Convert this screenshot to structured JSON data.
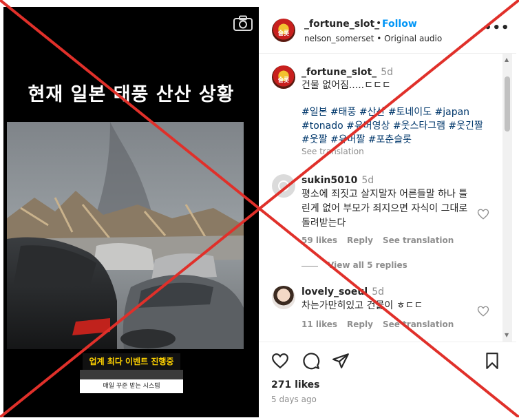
{
  "video": {
    "caption": "현재 일본 태풍 산산 상황",
    "banner_line1": "업계 최다 이벤트 진행중",
    "banner_line2": "",
    "banner_line3": "매일 꾸준 받는 시스템"
  },
  "header": {
    "username": "_fortune_slot_",
    "separator": "•",
    "follow_label": "Follow",
    "subtitle": "nelson_somerset • Original audio",
    "more": "•••"
  },
  "caption_post": {
    "username": "_fortune_slot_",
    "time": "5d",
    "text": "건물 없어짐.....ㄷㄷㄷ",
    "hashtags": "#일본 #태풍 #산산 #토네이도 #japan #tonado #유머영상 #웃스타그램 #웃긴짤 #웃짤 #유머짤 #포춘슬롯",
    "see_translation": "See translation"
  },
  "comments": [
    {
      "username": "sukin5010",
      "time": "5d",
      "text": "평소에 죄짓고 살지말자 어른들말 하나 틀린게 없어 부모가 죄지으면 자식이 그대로 돌려받는다",
      "likes": "59 likes",
      "reply": "Reply",
      "see_translation": "See translation",
      "view_replies": "View all 5 replies"
    },
    {
      "username": "lovely_soeul",
      "time": "5d",
      "text": "차는가만히있고 건물이 ㅎㄷㄷ",
      "likes": "11 likes",
      "reply": "Reply",
      "see_translation": "See translation"
    }
  ],
  "footer": {
    "likes": "271 likes",
    "time_ago": "5 days ago"
  },
  "colors": {
    "follow": "#0095f6",
    "hashtag": "#00376b",
    "muted": "#8e8e8e",
    "overlay_x": "#e0302a"
  },
  "icons": [
    "camera-icon",
    "more-icon",
    "heart-icon",
    "comment-icon",
    "share-icon",
    "bookmark-icon"
  ]
}
